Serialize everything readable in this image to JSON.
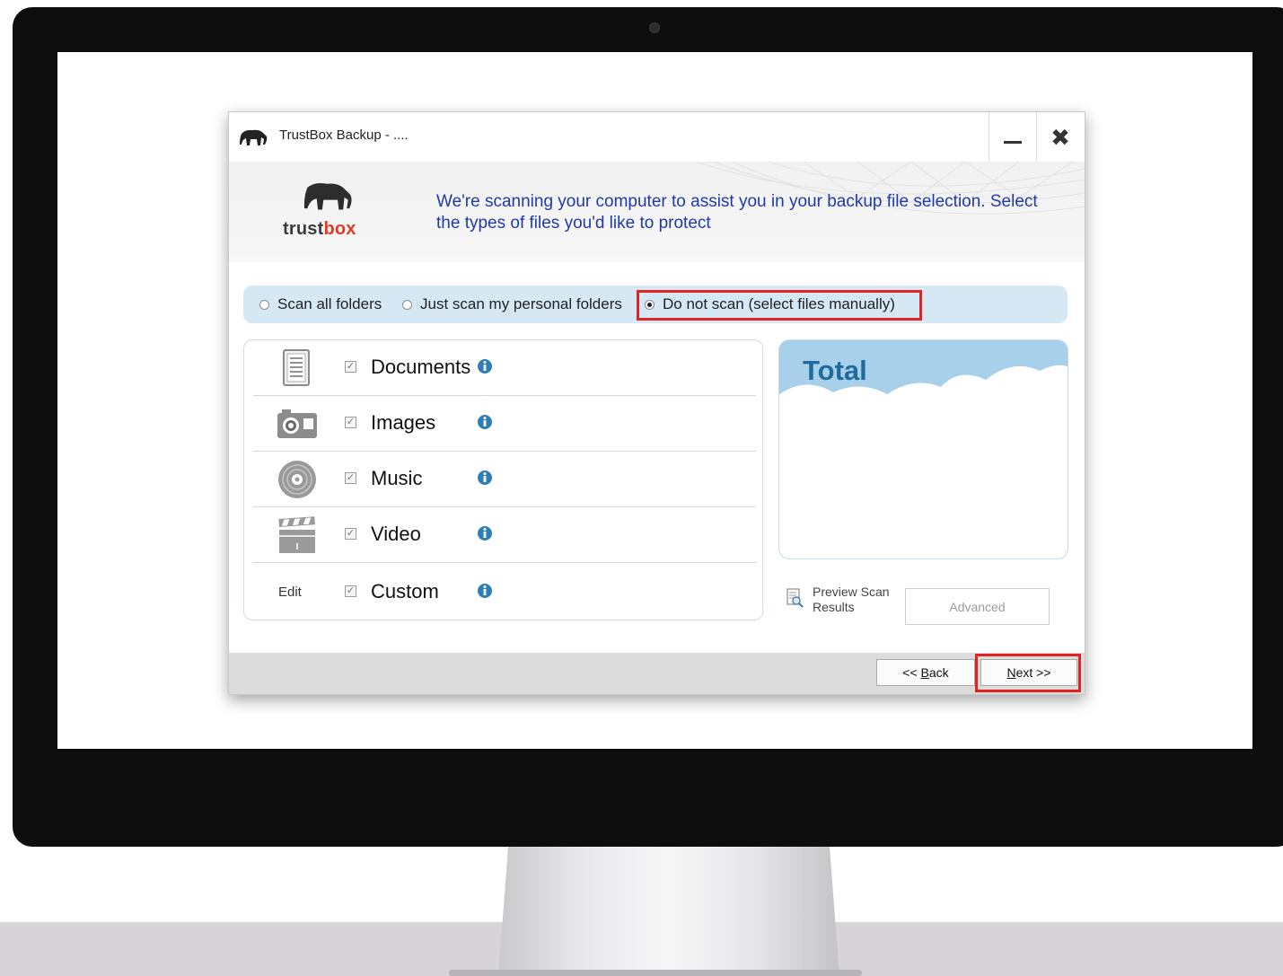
{
  "window": {
    "title": "TrustBox Backup  -  ....",
    "minimize_glyph": "—",
    "close_glyph": "✖"
  },
  "logo": {
    "part1": "trust",
    "part2": "box"
  },
  "header": {
    "message": "We're scanning your computer to assist you in your backup file selection. Select the types of files you'd like to protect"
  },
  "scan_options": [
    {
      "label": "Scan all folders",
      "checked": false
    },
    {
      "label": "Just scan my personal folders",
      "checked": false
    },
    {
      "label": "Do not scan (select files manually)",
      "checked": true
    }
  ],
  "file_types": [
    {
      "label": "Documents",
      "checked": true,
      "icon": "document-icon"
    },
    {
      "label": "Images",
      "checked": true,
      "icon": "camera-icon"
    },
    {
      "label": "Music",
      "checked": true,
      "icon": "music-disc-icon"
    },
    {
      "label": "Video",
      "checked": true,
      "icon": "clapperboard-icon"
    },
    {
      "label": "Custom",
      "checked": true,
      "edit_label": "Edit"
    }
  ],
  "total": {
    "title": "Total"
  },
  "preview": {
    "label_line1": "Preview Scan",
    "label_line2": "Results"
  },
  "advanced_label": "Advanced",
  "buttons": {
    "back_prefix": "<< ",
    "back_underlined": "B",
    "back_rest": "ack",
    "next_underlined": "N",
    "next_rest": "ext >>"
  },
  "colors": {
    "accent_blue": "#1f3aa8",
    "total_blue": "#1f6b9c",
    "highlight_red": "#e32222",
    "radio_band": "#d6e8f4",
    "logo_red": "#e23a26"
  }
}
